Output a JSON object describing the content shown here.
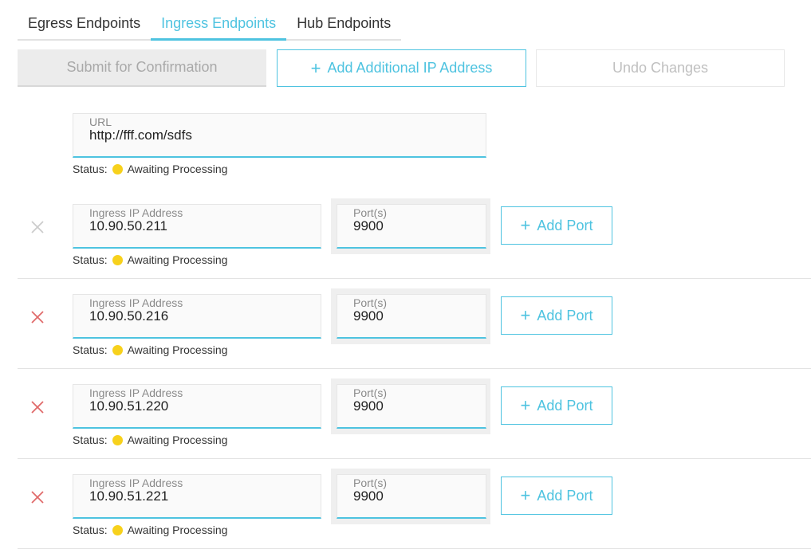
{
  "tabs": [
    {
      "label": "Egress Endpoints",
      "active": false
    },
    {
      "label": "Ingress Endpoints",
      "active": true
    },
    {
      "label": "Hub Endpoints",
      "active": false
    }
  ],
  "toolbar": {
    "submit_label": "Submit for Confirmation",
    "add_ip_label": "Add Additional IP Address",
    "undo_label": "Undo Changes",
    "plus_icon": "+"
  },
  "url_field": {
    "label": "URL",
    "value": "http://fff.com/sdfs",
    "status_key": "Status:",
    "status_value": "Awaiting Processing"
  },
  "entries": [
    {
      "ip_label": "Ingress IP Address",
      "ip": "10.90.50.211",
      "port_label": "Port(s)",
      "port": "9900",
      "add_port_label": "Add Port",
      "status_key": "Status:",
      "status_value": "Awaiting Processing",
      "remove_enabled": false
    },
    {
      "ip_label": "Ingress IP Address",
      "ip": "10.90.50.216",
      "port_label": "Port(s)",
      "port": "9900",
      "add_port_label": "Add Port",
      "status_key": "Status:",
      "status_value": "Awaiting Processing",
      "remove_enabled": true
    },
    {
      "ip_label": "Ingress IP Address",
      "ip": "10.90.51.220",
      "port_label": "Port(s)",
      "port": "9900",
      "add_port_label": "Add Port",
      "status_key": "Status:",
      "status_value": "Awaiting Processing",
      "remove_enabled": true
    },
    {
      "ip_label": "Ingress IP Address",
      "ip": "10.90.51.221",
      "port_label": "Port(s)",
      "port": "9900",
      "add_port_label": "Add Port",
      "status_key": "Status:",
      "status_value": "Awaiting Processing",
      "remove_enabled": true
    }
  ],
  "colors": {
    "accent": "#4ec3e0",
    "status_pending": "#f7d11c",
    "remove_enabled": "#e06a6a",
    "remove_disabled": "#cccccc"
  }
}
